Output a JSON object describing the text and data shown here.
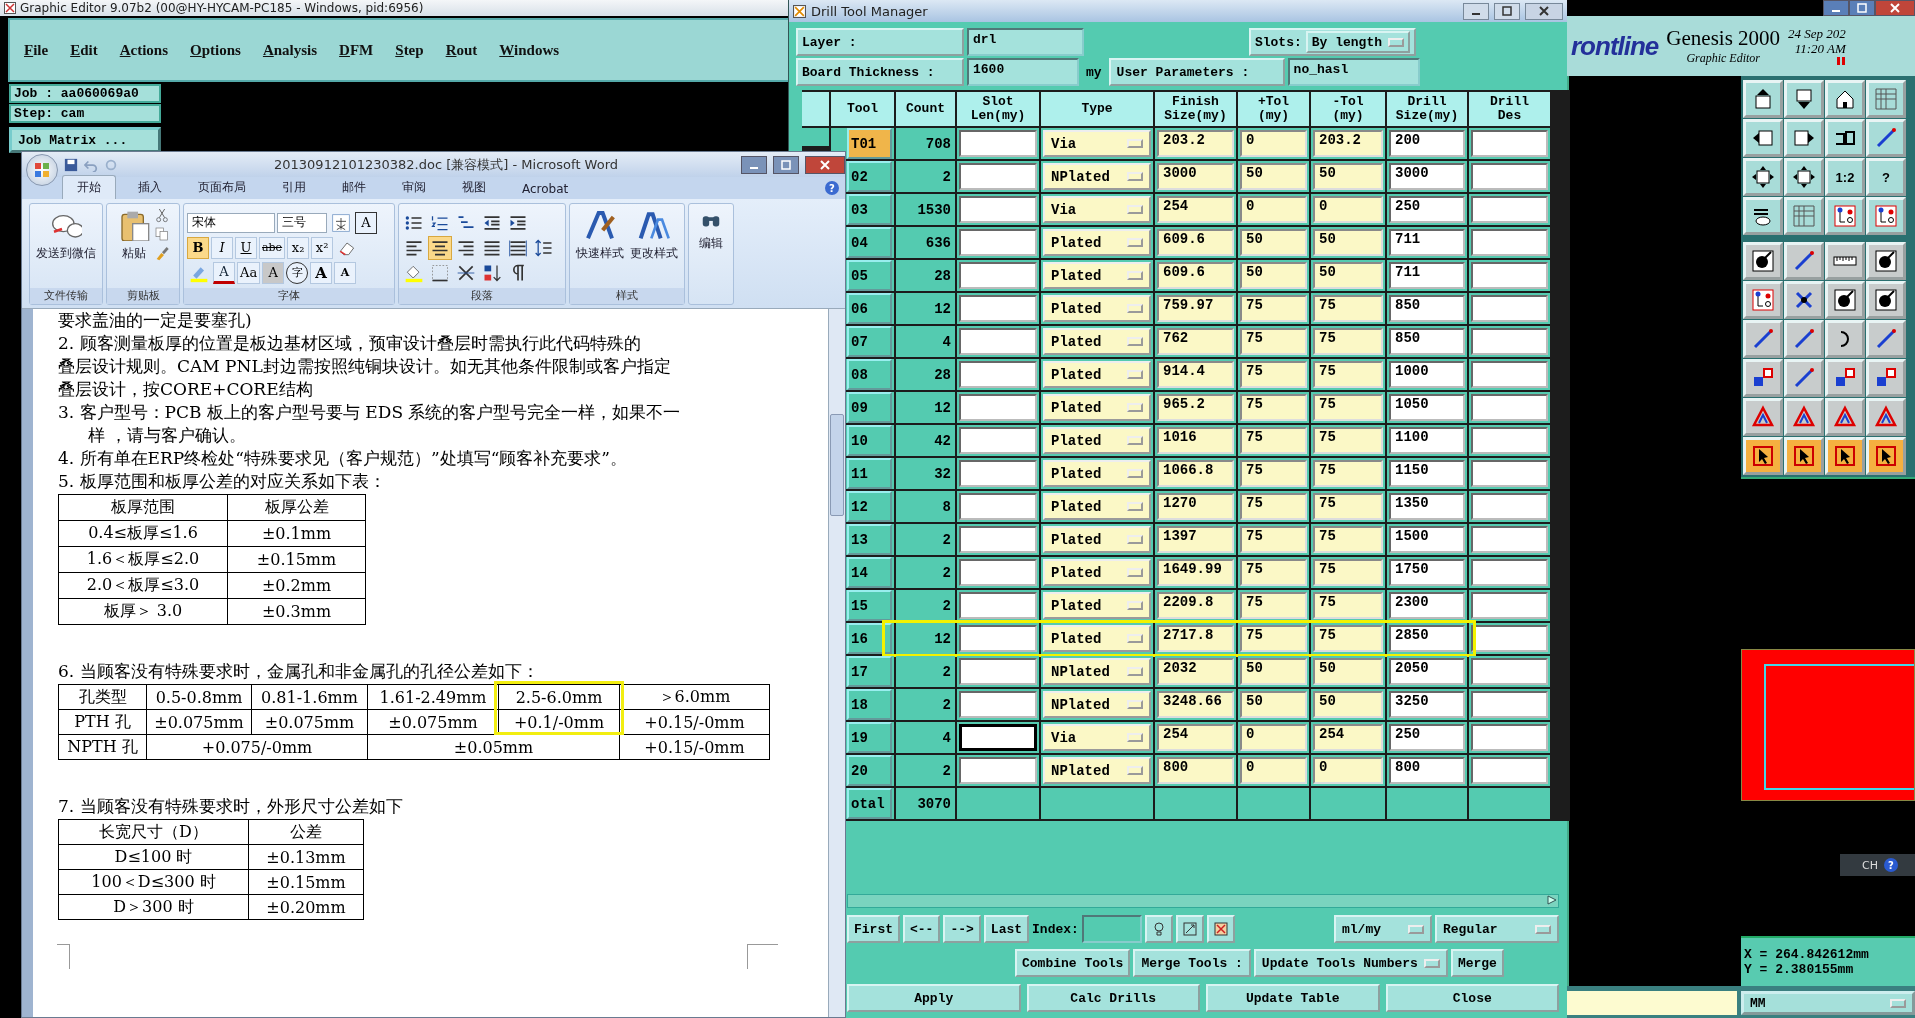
{
  "editor": {
    "title": "Graphic Editor 9.07b2 (00@HY-HYCAM-PC185 - Windows, pid:6956)",
    "menu": [
      "File",
      "Edit",
      "Actions",
      "Options",
      "Analysis",
      "DFM",
      "Step",
      "Rout",
      "Windows"
    ],
    "job": "Job : aa060069a0",
    "step": "Step: cam",
    "job_matrix": "Job Matrix ...",
    "brand": {
      "logo": "rontline",
      "product": "Genesis 2000",
      "subtitle": "Graphic Editor",
      "date": "24 Sep 202",
      "time": "11:20 AM"
    },
    "toolbar_texts": [
      "1:2",
      "?"
    ],
    "lang_bar": {
      "label": "CH",
      "help": "?"
    },
    "coords": [
      "X = 264.842612mm",
      "Y = 2.380155mm"
    ],
    "units": "MM"
  },
  "word": {
    "title": "20130912101230382.doc [兼容模式] - Microsoft Word",
    "tabs": [
      {
        "label": "开始",
        "selected": true
      },
      {
        "label": "插入",
        "selected": false
      },
      {
        "label": "页面布局",
        "selected": false
      },
      {
        "label": "引用",
        "selected": false
      },
      {
        "label": "邮件",
        "selected": false
      },
      {
        "label": "审阅",
        "selected": false
      },
      {
        "label": "视图",
        "selected": false
      },
      {
        "label": "Acrobat",
        "selected": false
      }
    ],
    "help": "?",
    "ribbon": {
      "send": {
        "button": "发送到微信",
        "caption": "文件传输"
      },
      "clipboard": {
        "button": "粘贴",
        "caption": "剪贴板"
      },
      "font": {
        "font": "宋体",
        "size": "三号",
        "caption": "字体",
        "row1": [
          {
            "kind": "icon"
          },
          {
            "kind": "boxed",
            "label": "A"
          }
        ],
        "row2": [
          {
            "kind": "letter",
            "label": "B",
            "selected": true
          },
          {
            "kind": "letter",
            "label": "I",
            "selected": false
          },
          {
            "kind": "letter",
            "label": "U",
            "selected": false
          },
          {
            "kind": "letter",
            "label": "abe",
            "selected": false
          },
          {
            "kind": "letter",
            "label": "x₂",
            "selected": false
          },
          {
            "kind": "letter",
            "label": "x²",
            "selected": false
          },
          {
            "kind": "icon",
            "selected": false
          }
        ],
        "row3": [
          {
            "kind": "icon"
          },
          {
            "kind": "color",
            "label": "A"
          },
          {
            "kind": "letter",
            "label": "Aa"
          },
          {
            "kind": "boxed",
            "label": "A"
          },
          {
            "kind": "circled",
            "label": "字"
          },
          {
            "kind": "grow",
            "label": "A"
          },
          {
            "kind": "shrink",
            "label": "A"
          }
        ]
      },
      "paragraph": {
        "caption": "段落",
        "align": [
          {
            "selected": false
          },
          {
            "selected": true
          },
          {
            "selected": false
          },
          {
            "selected": false
          },
          {
            "selected": false
          }
        ]
      },
      "styles": {
        "buttons": [
          "快速样式",
          "更改样式"
        ],
        "caption": "样式"
      },
      "editing": {
        "button": "编辑"
      }
    },
    "document": {
      "blocks": [
        {
          "kind": "para",
          "lines": [
            "要求盖油的一定是要塞孔)"
          ]
        },
        {
          "kind": "para",
          "lines": [
            "2.  顾客测量板厚的位置是板边基材区域，预审设计叠层时需执行此代码特殊的",
            "叠层设计规则。CAM PNL封边需按照纯铜块设计。如无其他条件限制或客户指定",
            "叠层设计，按CORE+CORE结构"
          ],
          "hanging": false
        },
        {
          "kind": "para",
          "lines": [
            "3. 客户型号：PCB 板上的客户型号要与 EDS 系统的客户型号完全一样，如果不一",
            "样 ，请与客户确认。"
          ],
          "hanging": true
        },
        {
          "kind": "para",
          "lines": [
            "4.  所有单在ERP终检处“特殊要求见（客户规范）”处填写“顾客补充要求”。"
          ]
        },
        {
          "kind": "para",
          "lines": [
            "5.  板厚范围和板厚公差的对应关系如下表："
          ]
        },
        {
          "kind": "table",
          "columns": [
            {
              "highlighted": false
            },
            {
              "highlighted": false
            }
          ],
          "rows": [
            {
              "cells": [
                {
                  "text": "板厚范围",
                  "wide": false
                },
                {
                  "text": "板厚公差",
                  "wide": false
                }
              ]
            },
            {
              "cells": [
                {
                  "text": "0.4≤板厚≤1.6",
                  "wide": false
                },
                {
                  "text": "±0.1mm",
                  "wide": false
                }
              ]
            },
            {
              "cells": [
                {
                  "text": "1.6＜板厚≤2.0",
                  "wide": false
                },
                {
                  "text": "±0.15mm",
                  "wide": false
                }
              ]
            },
            {
              "cells": [
                {
                  "text": "2.0＜板厚≤3.0",
                  "wide": false
                },
                {
                  "text": "±0.2mm",
                  "wide": false
                }
              ]
            },
            {
              "cells": [
                {
                  "text": "板厚＞  3.0",
                  "wide": false
                },
                {
                  "text": "±0.3mm",
                  "wide": false
                }
              ]
            }
          ]
        },
        {
          "kind": "blank"
        },
        {
          "kind": "para",
          "lines": [
            "6.  当顾客没有特殊要求时，金属孔和非金属孔的孔径公差如下："
          ]
        },
        {
          "kind": "table",
          "columns": [
            {
              "highlighted": false
            },
            {
              "highlighted": false
            },
            {
              "highlighted": false
            },
            {
              "highlighted": false
            },
            {
              "highlighted": true
            },
            {
              "highlighted": false
            }
          ],
          "rows": [
            {
              "cells": [
                {
                  "text": "孔类型",
                  "wide": false
                },
                {
                  "text": "0.5-0.8mm",
                  "wide": false
                },
                {
                  "text": "0.81-1.6mm",
                  "wide": false
                },
                {
                  "text": "1.61-2.49mm",
                  "wide": false
                },
                {
                  "text": "2.5-6.0mm",
                  "wide": false
                },
                {
                  "text": "＞6.0mm",
                  "wide": false
                }
              ]
            },
            {
              "cells": [
                {
                  "text": "PTH 孔",
                  "wide": false
                },
                {
                  "text": "±0.075mm",
                  "wide": false
                },
                {
                  "text": "±0.075mm",
                  "wide": false
                },
                {
                  "text": "±0.075mm",
                  "wide": false
                },
                {
                  "text": "+0.1/-0mm",
                  "wide": false
                },
                {
                  "text": "+0.15/-0mm",
                  "wide": false
                }
              ]
            },
            {
              "cells": [
                {
                  "text": "NPTH 孔",
                  "wide": false
                },
                {
                  "text": "+0.075/-0mm",
                  "wide": true,
                  "colspan": 2
                },
                {
                  "text": "±0.05mm",
                  "wide": true,
                  "colspan": 2
                },
                {
                  "text": "+0.15/-0mm",
                  "wide": false
                }
              ]
            }
          ]
        },
        {
          "kind": "blank"
        },
        {
          "kind": "para",
          "lines": [
            "7.  当顾客没有特殊要求时，外形尺寸公差如下"
          ]
        },
        {
          "kind": "table",
          "columns": [
            {
              "highlighted": false
            },
            {
              "highlighted": false
            }
          ],
          "rows": [
            {
              "cells": [
                {
                  "text": "长宽尺寸（D）",
                  "wide": false
                },
                {
                  "text": "公差",
                  "wide": false
                }
              ]
            },
            {
              "cells": [
                {
                  "text": "D≤100 时",
                  "wide": false
                },
                {
                  "text": "±0.13mm",
                  "wide": false
                }
              ]
            },
            {
              "cells": [
                {
                  "text": "100＜D≤300 时",
                  "wide": false
                },
                {
                  "text": "±0.15mm",
                  "wide": false
                }
              ]
            },
            {
              "cells": [
                {
                  "text": "D＞300 时",
                  "wide": false
                },
                {
                  "text": "±0.20mm",
                  "wide": false
                }
              ]
            }
          ]
        }
      ]
    }
  },
  "drill": {
    "title": "Drill Tool Manager",
    "layer_label": "Layer :",
    "layer": "drl",
    "slots_label": "Slots:",
    "slots": "By length",
    "thickness_label": "Board Thickness :",
    "thickness": "1600",
    "thickness_unit": "my",
    "params_button": "User Parameters :",
    "params": "no_hasl",
    "columns": [
      {
        "lines": [
          "Tool"
        ]
      },
      {
        "lines": [
          "Count"
        ]
      },
      {
        "lines": [
          "Slot",
          "Len(my)"
        ]
      },
      {
        "lines": [
          "Type"
        ]
      },
      {
        "lines": [
          "Finish",
          "Size(my)"
        ]
      },
      {
        "lines": [
          "+Tol",
          "(my)"
        ]
      },
      {
        "lines": [
          "-Tol",
          "(my)"
        ]
      },
      {
        "lines": [
          "Drill",
          "Size(my)"
        ]
      },
      {
        "lines": [
          "Drill",
          "Des"
        ]
      }
    ],
    "rows": [
      {
        "tool": "T01",
        "count": "708",
        "type": "Via",
        "finish": "203.2",
        "plus_tol": "0",
        "minus_tol": "203.2",
        "drill_size": "200",
        "selected": true,
        "highlighted": false,
        "focused": false
      },
      {
        "tool": "02",
        "count": "2",
        "type": "NPlated",
        "finish": "3000",
        "plus_tol": "50",
        "minus_tol": "50",
        "drill_size": "3000",
        "selected": false,
        "highlighted": false,
        "focused": false
      },
      {
        "tool": "03",
        "count": "1530",
        "type": "Via",
        "finish": "254",
        "plus_tol": "0",
        "minus_tol": "0",
        "drill_size": "250",
        "selected": false,
        "highlighted": false,
        "focused": false
      },
      {
        "tool": "04",
        "count": "636",
        "type": "Plated",
        "finish": "609.6",
        "plus_tol": "50",
        "minus_tol": "50",
        "drill_size": "711",
        "selected": false,
        "highlighted": false,
        "focused": false
      },
      {
        "tool": "05",
        "count": "28",
        "type": "Plated",
        "finish": "609.6",
        "plus_tol": "50",
        "minus_tol": "50",
        "drill_size": "711",
        "selected": false,
        "highlighted": false,
        "focused": false
      },
      {
        "tool": "06",
        "count": "12",
        "type": "Plated",
        "finish": "759.97",
        "plus_tol": "75",
        "minus_tol": "75",
        "drill_size": "850",
        "selected": false,
        "highlighted": false,
        "focused": false
      },
      {
        "tool": "07",
        "count": "4",
        "type": "Plated",
        "finish": "762",
        "plus_tol": "75",
        "minus_tol": "75",
        "drill_size": "850",
        "selected": false,
        "highlighted": false,
        "focused": false
      },
      {
        "tool": "08",
        "count": "28",
        "type": "Plated",
        "finish": "914.4",
        "plus_tol": "75",
        "minus_tol": "75",
        "drill_size": "1000",
        "selected": false,
        "highlighted": false,
        "focused": false
      },
      {
        "tool": "09",
        "count": "12",
        "type": "Plated",
        "finish": "965.2",
        "plus_tol": "75",
        "minus_tol": "75",
        "drill_size": "1050",
        "selected": false,
        "highlighted": false,
        "focused": false
      },
      {
        "tool": "10",
        "count": "42",
        "type": "Plated",
        "finish": "1016",
        "plus_tol": "75",
        "minus_tol": "75",
        "drill_size": "1100",
        "selected": false,
        "highlighted": false,
        "focused": false
      },
      {
        "tool": "11",
        "count": "32",
        "type": "Plated",
        "finish": "1066.8",
        "plus_tol": "75",
        "minus_tol": "75",
        "drill_size": "1150",
        "selected": false,
        "highlighted": false,
        "focused": false
      },
      {
        "tool": "12",
        "count": "8",
        "type": "Plated",
        "finish": "1270",
        "plus_tol": "75",
        "minus_tol": "75",
        "drill_size": "1350",
        "selected": false,
        "highlighted": false,
        "focused": false
      },
      {
        "tool": "13",
        "count": "2",
        "type": "Plated",
        "finish": "1397",
        "plus_tol": "75",
        "minus_tol": "75",
        "drill_size": "1500",
        "selected": false,
        "highlighted": false,
        "focused": false
      },
      {
        "tool": "14",
        "count": "2",
        "type": "Plated",
        "finish": "1649.99",
        "plus_tol": "75",
        "minus_tol": "75",
        "drill_size": "1750",
        "selected": false,
        "highlighted": false,
        "focused": false
      },
      {
        "tool": "15",
        "count": "2",
        "type": "Plated",
        "finish": "2209.8",
        "plus_tol": "75",
        "minus_tol": "75",
        "drill_size": "2300",
        "selected": false,
        "highlighted": false,
        "focused": false
      },
      {
        "tool": "16",
        "count": "12",
        "type": "Plated",
        "finish": "2717.8",
        "plus_tol": "75",
        "minus_tol": "75",
        "drill_size": "2850",
        "selected": false,
        "highlighted": true,
        "focused": false
      },
      {
        "tool": "17",
        "count": "2",
        "type": "NPlated",
        "finish": "2032",
        "plus_tol": "50",
        "minus_tol": "50",
        "drill_size": "2050",
        "selected": false,
        "highlighted": false,
        "focused": false
      },
      {
        "tool": "18",
        "count": "2",
        "type": "NPlated",
        "finish": "3248.66",
        "plus_tol": "50",
        "minus_tol": "50",
        "drill_size": "3250",
        "selected": false,
        "highlighted": false,
        "focused": false
      },
      {
        "tool": "19",
        "count": "4",
        "type": "Via",
        "finish": "254",
        "plus_tol": "0",
        "minus_tol": "254",
        "drill_size": "250",
        "selected": false,
        "highlighted": false,
        "focused": true
      },
      {
        "tool": "20",
        "count": "2",
        "type": "NPlated",
        "finish": "800",
        "plus_tol": "0",
        "minus_tol": "0",
        "drill_size": "800",
        "selected": false,
        "highlighted": false,
        "focused": false
      }
    ],
    "total": {
      "label": "otal",
      "count": "3070"
    },
    "nav": {
      "buttons": [
        "First",
        "<--",
        "-->",
        "Last"
      ],
      "index_label": "Index:",
      "units": "ml/my",
      "mode": "Regular"
    },
    "actions": {
      "combine": "Combine Tools",
      "merge_label": "Merge Tools :",
      "update": "Update Tools Numbers",
      "merge": "Merge"
    },
    "bottom_buttons": [
      "Apply",
      "Calc Drills",
      "Update Table",
      "Close"
    ]
  }
}
